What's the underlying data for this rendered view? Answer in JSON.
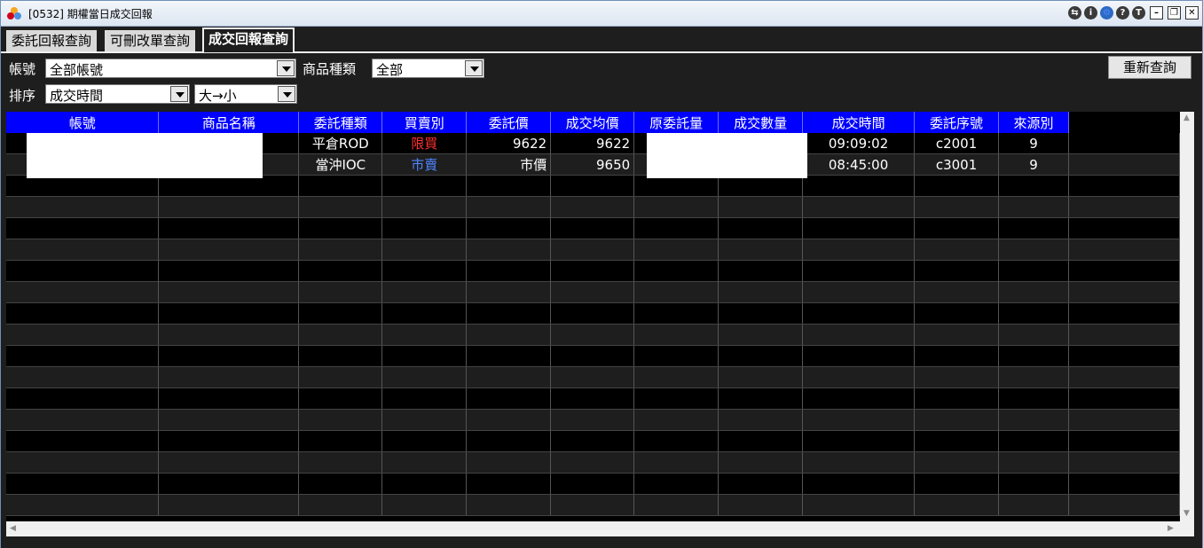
{
  "window": {
    "title": "[0532] 期權當日成交回報"
  },
  "tabs": [
    {
      "label": "委託回報查詢",
      "active": false
    },
    {
      "label": "可刪改單查詢",
      "active": false
    },
    {
      "label": "成交回報查詢",
      "active": true
    }
  ],
  "filters": {
    "account_label": "帳號",
    "account_value": "全部帳號",
    "product_label": "商品種類",
    "product_value": "全部",
    "sort_label": "排序",
    "sort_value": "成交時間",
    "order_value": "大→小",
    "refresh_label": "重新查詢"
  },
  "columns": [
    "帳號",
    "商品名稱",
    "委託種類",
    "買賣別",
    "委託價",
    "成交均價",
    "原委託量",
    "成交數量",
    "成交時間",
    "委託序號",
    "來源別"
  ],
  "rows": [
    {
      "account": "",
      "product": "",
      "order_type": "平倉ROD",
      "side": "限買",
      "side_color": "#ff3030",
      "price": "9622",
      "avg_price": "9622",
      "orig_qty": "",
      "filled_qty": "",
      "time": "09:09:02",
      "seq": "c2001",
      "source": "9"
    },
    {
      "account": "",
      "product": "",
      "order_type": "當沖IOC",
      "side": "市賣",
      "side_color": "#4f86ff",
      "price": "市價",
      "avg_price": "9650",
      "orig_qty": "",
      "filled_qty": "",
      "time": "08:45:00",
      "seq": "c3001",
      "source": "9"
    }
  ],
  "colors": {
    "header_bg": "#0000ff",
    "buy": "#ff3030",
    "sell": "#4f86ff"
  }
}
